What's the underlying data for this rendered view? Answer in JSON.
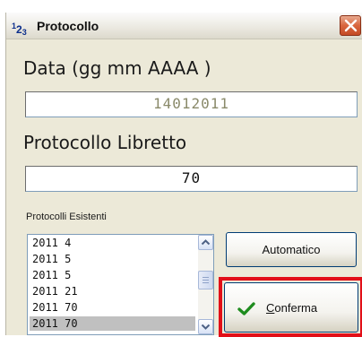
{
  "window": {
    "title": "Protocollo",
    "icon_label": {
      "sup": "1",
      "mid": "2",
      "sub": "3"
    }
  },
  "data_field": {
    "label": "Data (gg mm AAAA )",
    "value": "14012011",
    "value_color": "#8a8a6a"
  },
  "protocollo_field": {
    "label": "Protocollo Libretto",
    "value": "70"
  },
  "existing": {
    "label": "Protocolli Esistenti",
    "items": [
      "2011 4",
      "2011 5",
      "2011 5",
      "2011 21",
      "2011 70",
      "2011 70"
    ],
    "selected_index": 5
  },
  "buttons": {
    "automatico": "Automatico",
    "conferma": "Conferma",
    "conferma_accel": "C"
  },
  "colors": {
    "highlight": "#e20f18",
    "check": "#1e8c1e"
  },
  "icons": {
    "close": "close-icon",
    "check": "checkmark-icon",
    "up": "scroll-up-icon",
    "down": "scroll-down-icon"
  }
}
